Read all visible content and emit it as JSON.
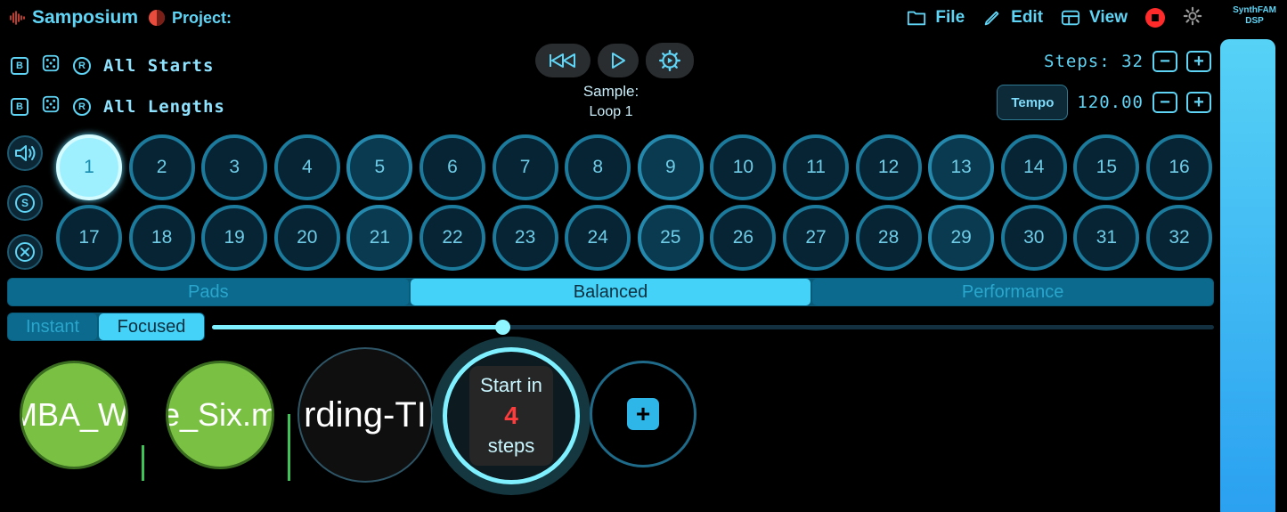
{
  "app": {
    "name": "Samposium",
    "project_label": "Project:",
    "brand_line1": "SynthFAM",
    "brand_line2": "DSP"
  },
  "menu": {
    "file": "File",
    "edit": "Edit",
    "view": "View"
  },
  "rows": [
    {
      "b": "B",
      "r": "R",
      "label": "All Starts"
    },
    {
      "b": "B",
      "r": "R",
      "label": "All Lengths"
    }
  ],
  "sample": {
    "label": "Sample:",
    "value": "Loop 1"
  },
  "steps": {
    "label": "Steps: 32",
    "minus": "−",
    "plus": "+"
  },
  "tempo": {
    "button": "Tempo",
    "value": "120.00",
    "minus": "−",
    "plus": "+"
  },
  "side": {
    "solo": "S"
  },
  "pads": [
    "1",
    "2",
    "3",
    "4",
    "5",
    "6",
    "7",
    "8",
    "9",
    "10",
    "11",
    "12",
    "13",
    "14",
    "15",
    "16",
    "17",
    "18",
    "19",
    "20",
    "21",
    "22",
    "23",
    "24",
    "25",
    "26",
    "27",
    "28",
    "29",
    "30",
    "31",
    "32"
  ],
  "active_pad": "1",
  "modes": [
    "Pads",
    "Balanced",
    "Performance"
  ],
  "active_mode": "Balanced",
  "trigger_modes": [
    "Instant",
    "Focused"
  ],
  "active_trigger_mode": "Focused",
  "slider_value": 0.29,
  "tiles": {
    "t1": "MBA_WI",
    "t2": "e_Six.m",
    "t3": "rding-TI",
    "start_line1": "Start in",
    "start_count": "4",
    "start_line2": "steps",
    "add": "+"
  },
  "colors": {
    "accent": "#5fd4f5",
    "pad_active": "#9ff0ff",
    "record": "#ff2a2a",
    "tile_green": "#7ac143",
    "start_count": "#ff3b3b"
  }
}
